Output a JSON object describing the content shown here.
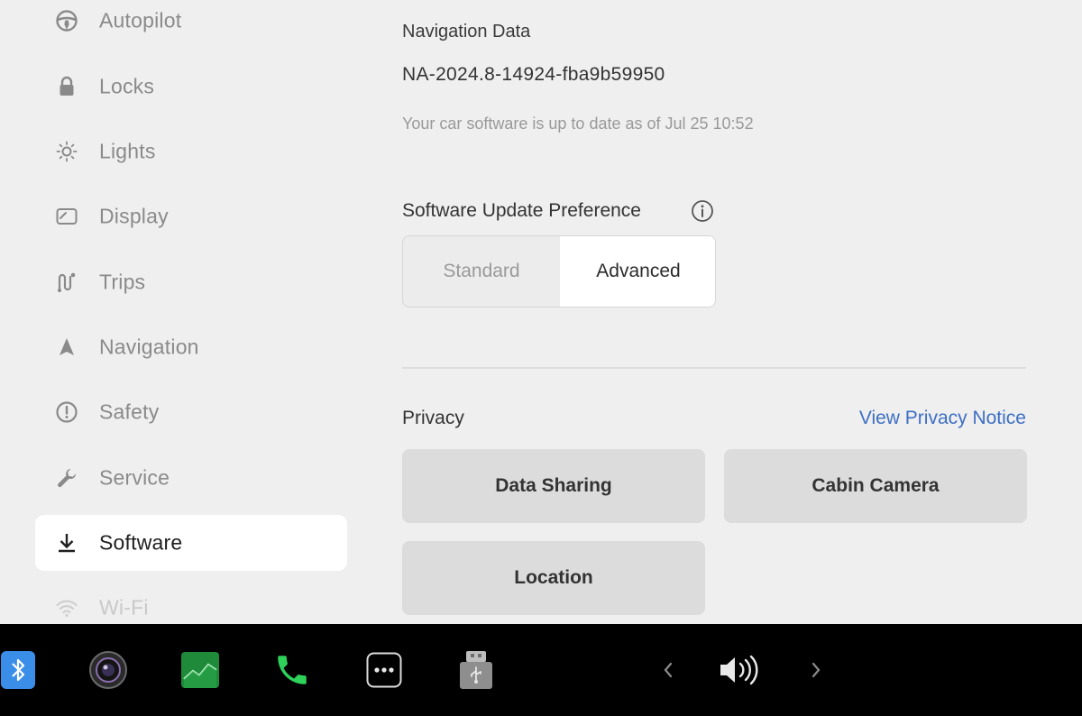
{
  "sidebar": {
    "items": [
      {
        "label": "Autopilot",
        "icon": "steering-wheel-icon"
      },
      {
        "label": "Locks",
        "icon": "lock-icon"
      },
      {
        "label": "Lights",
        "icon": "light-bulb-icon"
      },
      {
        "label": "Display",
        "icon": "display-icon"
      },
      {
        "label": "Trips",
        "icon": "trips-icon"
      },
      {
        "label": "Navigation",
        "icon": "navigation-arrow-icon"
      },
      {
        "label": "Safety",
        "icon": "safety-alert-icon"
      },
      {
        "label": "Service",
        "icon": "wrench-icon"
      },
      {
        "label": "Software",
        "icon": "download-icon",
        "active": true
      },
      {
        "label": "Wi-Fi",
        "icon": "wifi-icon"
      }
    ]
  },
  "software": {
    "nav_data_title": "Navigation Data",
    "nav_data_version": "NA-2024.8-14924-fba9b59950",
    "up_to_date_text": "Your car software is up to date as of Jul 25 10:52",
    "update_pref_title": "Software Update Preference",
    "update_pref_options": [
      "Standard",
      "Advanced"
    ],
    "update_pref_selected": "Advanced"
  },
  "privacy": {
    "title": "Privacy",
    "notice_link": "View Privacy Notice",
    "buttons": [
      "Data Sharing",
      "Cabin Camera",
      "Location"
    ]
  },
  "colors": {
    "accent_link": "#3d6fc4",
    "background": "#efefef",
    "taskbar": "#000000"
  },
  "taskbar": {
    "icons": [
      "bluetooth-icon",
      "camera-icon",
      "stocks-chart-icon",
      "phone-icon",
      "more-icon",
      "usb-drive-icon",
      "chevron-left-icon",
      "volume-icon",
      "chevron-right-icon"
    ]
  }
}
